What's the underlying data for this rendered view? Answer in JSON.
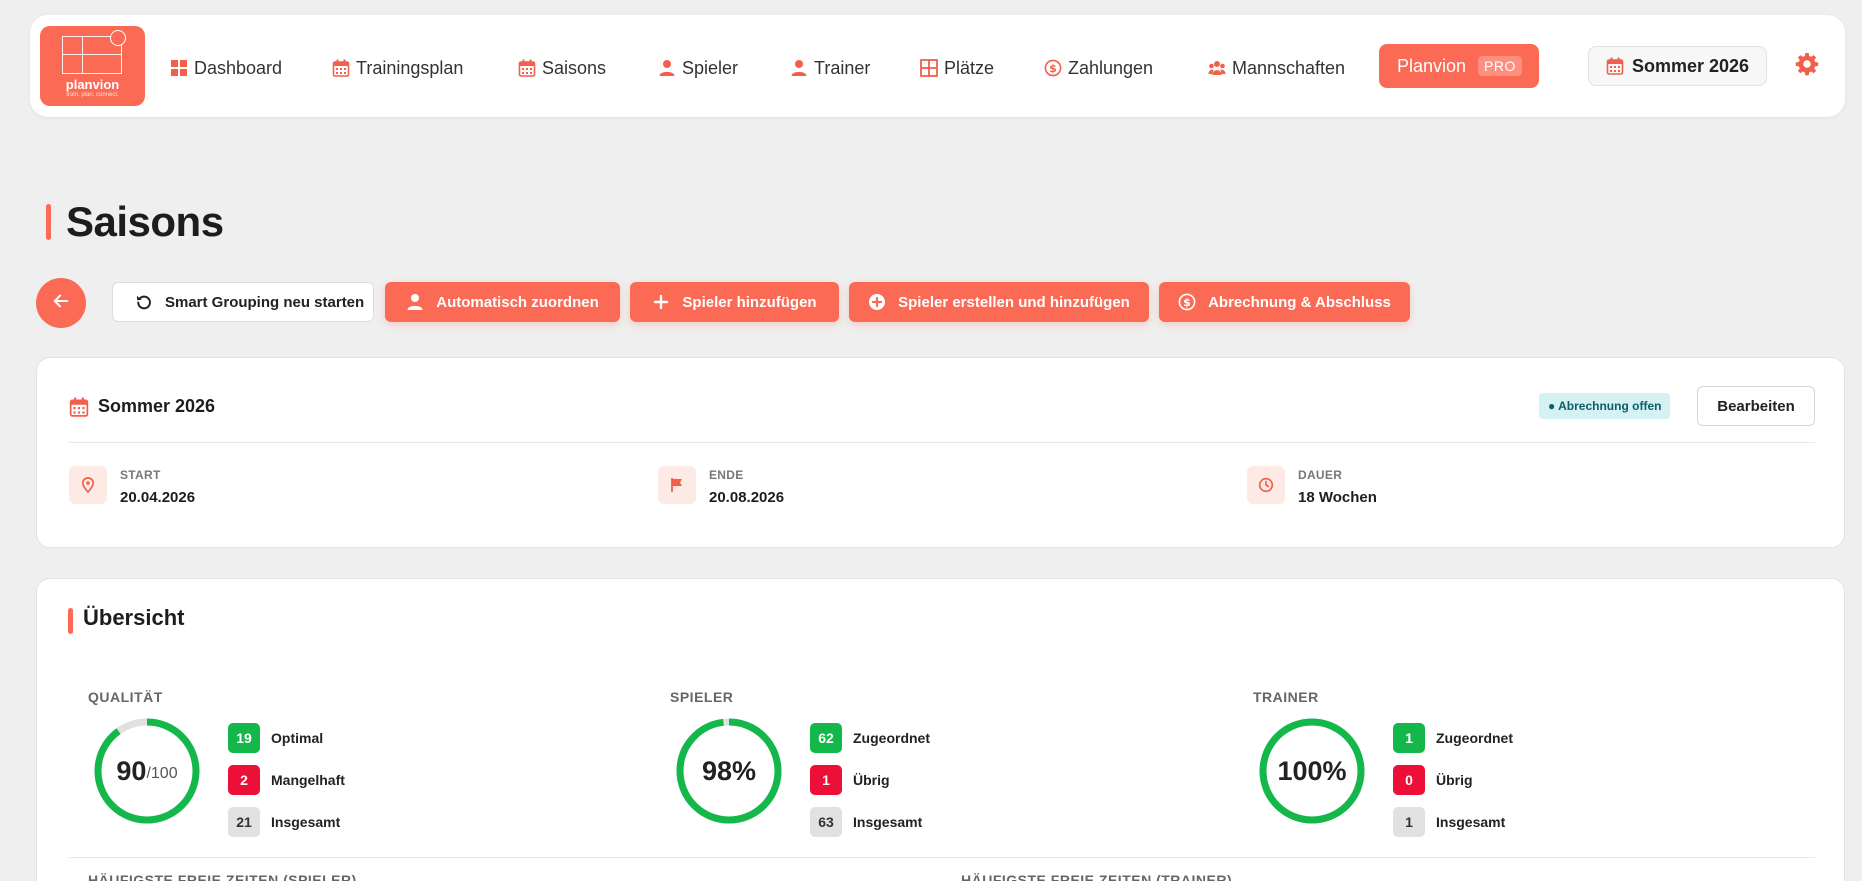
{
  "brand": {
    "name": "planvion",
    "tagline": "train. plan. connect."
  },
  "nav": {
    "items": [
      {
        "label": "Dashboard",
        "icon": "dashboard-icon"
      },
      {
        "label": "Trainingsplan",
        "icon": "calendar-icon"
      },
      {
        "label": "Saisons",
        "icon": "calendar-icon"
      },
      {
        "label": "Spieler",
        "icon": "user-icon"
      },
      {
        "label": "Trainer",
        "icon": "user-icon"
      },
      {
        "label": "Plätze",
        "icon": "grid-icon"
      },
      {
        "label": "Zahlungen",
        "icon": "dollar-icon"
      },
      {
        "label": "Mannschaften",
        "icon": "users-icon"
      }
    ],
    "pro_label": "Planvion",
    "pro_badge": "PRO",
    "season_selector": "Sommer 2026"
  },
  "page": {
    "title": "Saisons"
  },
  "actions": {
    "restart": "Smart Grouping neu starten",
    "auto_assign": "Automatisch zuordnen",
    "add_player": "Spieler hinzufügen",
    "create_player": "Spieler erstellen und hinzufügen",
    "billing": "Abrechnung & Abschluss"
  },
  "season": {
    "name": "Sommer 2026",
    "status": "● Abrechnung offen",
    "edit_label": "Bearbeiten",
    "start_label": "START",
    "start_value": "20.04.2026",
    "end_label": "ENDE",
    "end_value": "20.08.2026",
    "duration_label": "DAUER",
    "duration_value": "18 Wochen"
  },
  "overview": {
    "title": "Übersicht",
    "quality": {
      "label": "QUALITÄT",
      "score": "90",
      "score_suffix": "/100",
      "percent": 90,
      "optimal_count": "19",
      "optimal_label": "Optimal",
      "poor_count": "2",
      "poor_label": "Mangelhaft",
      "total_count": "21",
      "total_label": "Insgesamt"
    },
    "players": {
      "label": "SPIELER",
      "value": "98%",
      "percent": 98,
      "assigned_count": "62",
      "assigned_label": "Zugeordnet",
      "remaining_count": "1",
      "remaining_label": "Übrig",
      "total_count": "63",
      "total_label": "Insgesamt"
    },
    "trainers": {
      "label": "TRAINER",
      "value": "100%",
      "percent": 100,
      "assigned_count": "1",
      "assigned_label": "Zugeordnet",
      "remaining_count": "0",
      "remaining_label": "Übrig",
      "total_count": "1",
      "total_label": "Insgesamt"
    },
    "free_times_players": "HÄUFIGSTE FREIE ZEITEN (SPIELER)",
    "free_times_trainers": "HÄUFIGSTE FREIE ZEITEN (TRAINER)"
  },
  "colors": {
    "accent": "#fb6a55",
    "success": "#14b84a",
    "danger": "#ec0f37",
    "info_bg": "#d4f1f3"
  }
}
